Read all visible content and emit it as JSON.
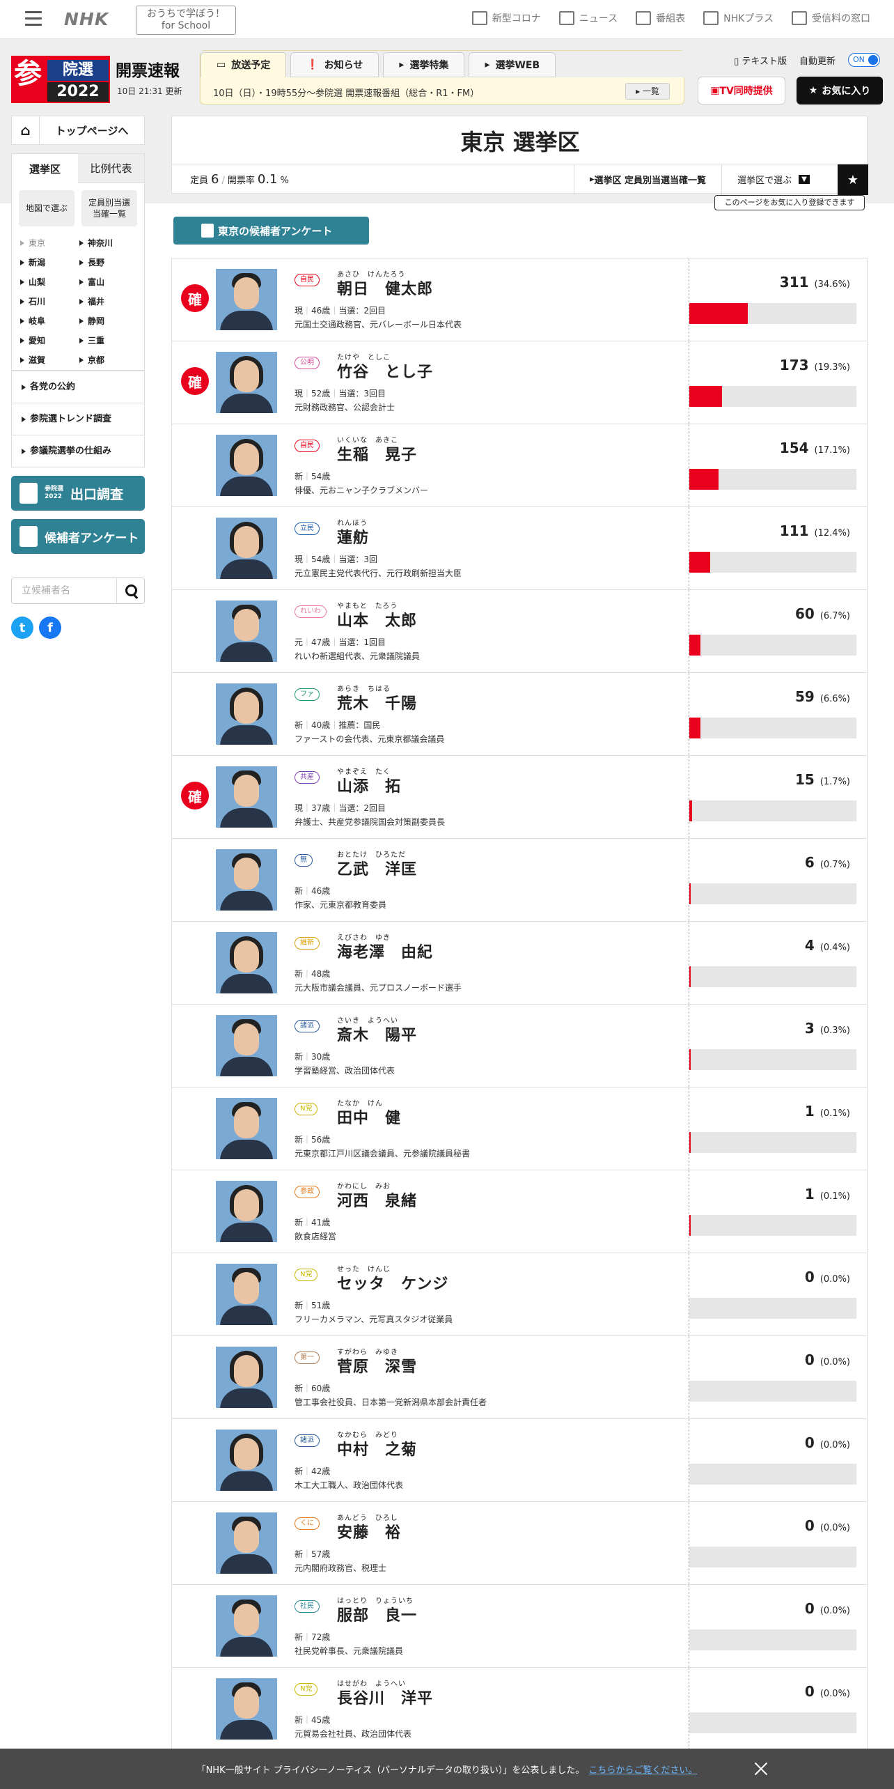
{
  "header": {
    "logo": "NHK",
    "school_line1": "おうちで学ぼう！",
    "school_line2": "for School",
    "nav": [
      {
        "label": "新型コロナ",
        "icon": "virus-icon"
      },
      {
        "label": "ニュース",
        "icon": "news-icon"
      },
      {
        "label": "番組表",
        "icon": "grid-icon"
      },
      {
        "label": "NHKプラス",
        "icon": "plus-icon"
      },
      {
        "label": "受信料の窓口",
        "icon": "tv-icon"
      }
    ]
  },
  "brand": {
    "san": "参",
    "in": "院選",
    "year": "2022",
    "title": "開票速報",
    "updated": "10日 21:31 更新"
  },
  "tabs": {
    "items": [
      "放送予定",
      "お知らせ",
      "選挙特集",
      "選挙WEB"
    ],
    "schedule": "10日（日）・19時55分～参院選 開票速報番組（総合・R1・FM）",
    "list_link": "一覧"
  },
  "utility": {
    "text_version": "テキスト版",
    "auto_update": "自動更新",
    "toggle": "ON",
    "tv_button": "TV同時提供",
    "fav_button": "お気に入り"
  },
  "sidebar": {
    "top_link": "トップページへ",
    "tab_district": "選挙区",
    "tab_proportional": "比例代表",
    "map_button": "地図で選ぶ",
    "list_button_1": "定員別当選",
    "list_button_2": "当確一覧",
    "prefectures": [
      "東京",
      "神奈川",
      "新潟",
      "長野",
      "山梨",
      "富山",
      "石川",
      "福井",
      "岐阜",
      "静岡",
      "愛知",
      "三重",
      "滋賀",
      "京都"
    ],
    "menu": [
      "各党の公約",
      "参院選トレンド調査",
      "参議院選挙の仕組み"
    ],
    "exit_poll_small_1": "参院選",
    "exit_poll_small_2": "2022",
    "exit_poll": "出口調査",
    "survey": "候補者アンケート",
    "search_placeholder": "立候補者名"
  },
  "main": {
    "title": "東京 選挙区",
    "teiin_label": "定員",
    "teiin_value": "6",
    "rate_label": "開票率",
    "rate_value": "0.1",
    "rate_unit": "%",
    "link_list": "選挙区 定員別当選当確一覧",
    "link_select": "選挙区で選ぶ",
    "tooltip": "このページをお気に入り登録できます",
    "survey_button": "東京の候補者アンケート"
  },
  "candidates": [
    {
      "kakutei": "確",
      "party": "自民",
      "party_color": "#e8001c",
      "kana": "あさひ　けんたろう",
      "name": "朝日　健太郎",
      "status": "現",
      "age": "46歳",
      "extra": "当選：2回目",
      "career": "元国土交通政務官、元バレーボール日本代表",
      "votes": "311",
      "pct": "(34.6%)",
      "share": 0.346,
      "female": false
    },
    {
      "kakutei": "確",
      "party": "公明",
      "party_color": "#d84a9a",
      "kana": "たけや　としこ",
      "name": "竹谷　とし子",
      "status": "現",
      "age": "52歳",
      "extra": "当選：3回目",
      "career": "元財務政務官、公認会計士",
      "votes": "173",
      "pct": "(19.3%)",
      "share": 0.193,
      "female": true
    },
    {
      "kakutei": "",
      "party": "自民",
      "party_color": "#e8001c",
      "kana": "いくいな　あきこ",
      "name": "生稲　晃子",
      "status": "新",
      "age": "54歳",
      "extra": "",
      "career": "俳優、元おニャン子クラブメンバー",
      "votes": "154",
      "pct": "(17.1%)",
      "share": 0.171,
      "female": true
    },
    {
      "kakutei": "",
      "party": "立民",
      "party_color": "#1f5fb0",
      "kana": "れんほう",
      "name": "蓮舫",
      "status": "現",
      "age": "54歳",
      "extra": "当選：3回",
      "career": "元立憲民主党代表代行、元行政刷新担当大臣",
      "votes": "111",
      "pct": "(12.4%)",
      "share": 0.124,
      "female": true
    },
    {
      "kakutei": "",
      "party": "れいわ",
      "party_color": "#e87aa0",
      "kana": "やまもと　たろう",
      "name": "山本　太郎",
      "status": "元",
      "age": "47歳",
      "extra": "当選：1回目",
      "career": "れいわ新選組代表、元衆議院議員",
      "votes": "60",
      "pct": "(6.7%)",
      "share": 0.067,
      "female": false
    },
    {
      "kakutei": "",
      "party": "ファ",
      "party_color": "#1f9a6a",
      "kana": "あらき　ちはる",
      "name": "荒木　千陽",
      "status": "新",
      "age": "40歳",
      "extra": "推薦：国民",
      "career": "ファーストの会代表、元東京都議会議員",
      "votes": "59",
      "pct": "(6.6%)",
      "share": 0.066,
      "female": true
    },
    {
      "kakutei": "確",
      "party": "共産",
      "party_color": "#7a3fb0",
      "kana": "やまぞえ　たく",
      "name": "山添　拓",
      "status": "現",
      "age": "37歳",
      "extra": "当選：2回目",
      "career": "弁護士、共産党参議院国会対策副委員長",
      "votes": "15",
      "pct": "(1.7%)",
      "share": 0.017,
      "female": false
    },
    {
      "kakutei": "",
      "party": "無",
      "party_color": "#2a5a9a",
      "kana": "おとたけ　ひろただ",
      "name": "乙武　洋匡",
      "status": "新",
      "age": "46歳",
      "extra": "",
      "career": "作家、元東京都教育委員",
      "votes": "6",
      "pct": "(0.7%)",
      "share": 0.007,
      "female": false
    },
    {
      "kakutei": "",
      "party": "維新",
      "party_color": "#d8a000",
      "kana": "えびさわ　ゆき",
      "name": "海老澤　由紀",
      "status": "新",
      "age": "48歳",
      "extra": "",
      "career": "元大阪市議会議員、元プロスノーボード選手",
      "votes": "4",
      "pct": "(0.4%)",
      "share": 0.004,
      "female": true
    },
    {
      "kakutei": "",
      "party": "諸派",
      "party_color": "#2a5a9a",
      "kana": "さいき　ようへい",
      "name": "斎木　陽平",
      "status": "新",
      "age": "30歳",
      "extra": "",
      "career": "学習塾経営、政治団体代表",
      "votes": "3",
      "pct": "(0.3%)",
      "share": 0.003,
      "female": false
    },
    {
      "kakutei": "",
      "party": "N党",
      "party_color": "#c8b800",
      "kana": "たなか　けん",
      "name": "田中　健",
      "status": "新",
      "age": "56歳",
      "extra": "",
      "career": "元東京都江戸川区議会議員、元参議院議員秘書",
      "votes": "1",
      "pct": "(0.1%)",
      "share": 0.001,
      "female": false
    },
    {
      "kakutei": "",
      "party": "参政",
      "party_color": "#e87a1a",
      "kana": "かわにし　みお",
      "name": "河西　泉緒",
      "status": "新",
      "age": "41歳",
      "extra": "",
      "career": "飲食店経営",
      "votes": "1",
      "pct": "(0.1%)",
      "share": 0.001,
      "female": true
    },
    {
      "kakutei": "",
      "party": "N党",
      "party_color": "#c8b800",
      "kana": "せった　けんじ",
      "name": "セッタ　ケンジ",
      "status": "新",
      "age": "51歳",
      "extra": "",
      "career": "フリーカメラマン、元写真スタジオ従業員",
      "votes": "0",
      "pct": "(0.0%)",
      "share": 0,
      "female": false
    },
    {
      "kakutei": "",
      "party": "第一",
      "party_color": "#b07a50",
      "kana": "すがわら　みゆき",
      "name": "菅原　深雪",
      "status": "新",
      "age": "60歳",
      "extra": "",
      "career": "管工事会社役員、日本第一党新潟県本部会計責任者",
      "votes": "0",
      "pct": "(0.0%)",
      "share": 0,
      "female": true
    },
    {
      "kakutei": "",
      "party": "諸派",
      "party_color": "#2a5a9a",
      "kana": "なかむら　みどり",
      "name": "中村　之菊",
      "status": "新",
      "age": "42歳",
      "extra": "",
      "career": "木工大工職人、政治団体代表",
      "votes": "0",
      "pct": "(0.0%)",
      "share": 0,
      "female": true
    },
    {
      "kakutei": "",
      "party": "くに",
      "party_color": "#e87a1a",
      "kana": "あんどう　ひろし",
      "name": "安藤　裕",
      "status": "新",
      "age": "57歳",
      "extra": "",
      "career": "元内閣府政務官、税理士",
      "votes": "0",
      "pct": "(0.0%)",
      "share": 0,
      "female": false
    },
    {
      "kakutei": "",
      "party": "社民",
      "party_color": "#2a8a9a",
      "kana": "はっとり　りょういち",
      "name": "服部　良一",
      "status": "新",
      "age": "72歳",
      "extra": "",
      "career": "社民党幹事長、元衆議院議員",
      "votes": "0",
      "pct": "(0.0%)",
      "share": 0,
      "female": false
    },
    {
      "kakutei": "",
      "party": "N党",
      "party_color": "#c8b800",
      "kana": "はせがわ　ようへい",
      "name": "長谷川　洋平",
      "status": "新",
      "age": "45歳",
      "extra": "",
      "career": "元貿易会社社員、政治団体代表",
      "votes": "0",
      "pct": "(0.0%)",
      "share": 0,
      "female": false
    }
  ],
  "notice": {
    "text": "「NHK一般サイト プライバシーノーティス（パーソナルデータの取り扱い）」を公表しました。",
    "link": "こちらからご覧ください。"
  }
}
